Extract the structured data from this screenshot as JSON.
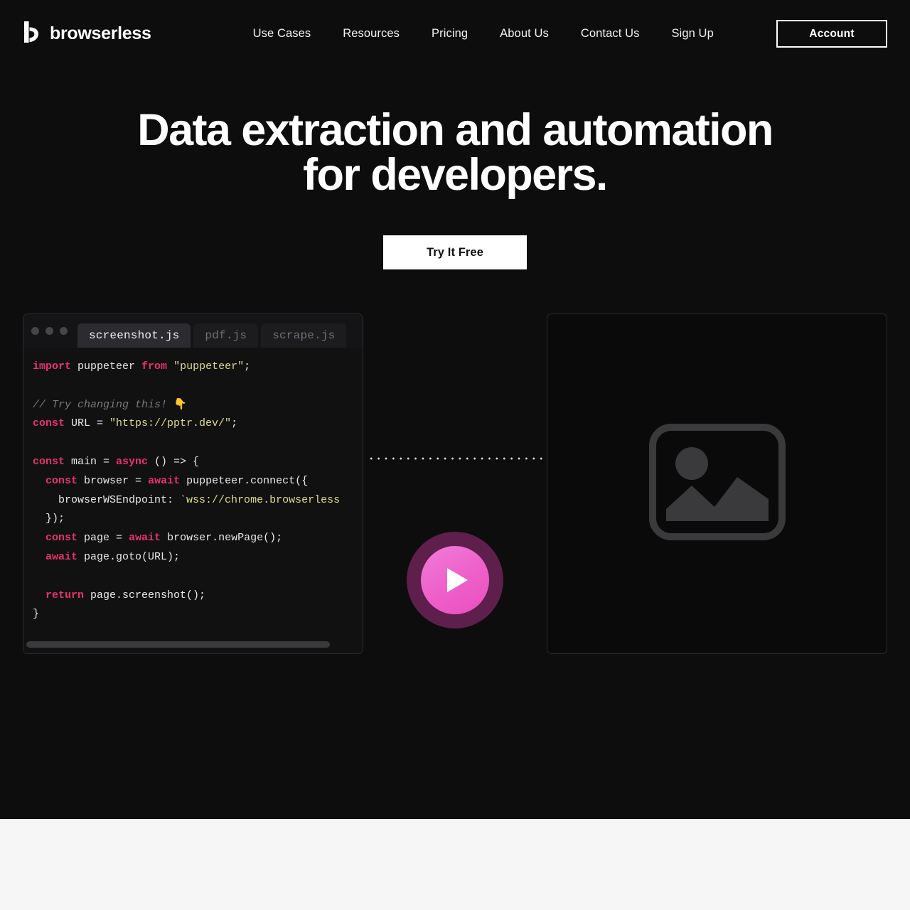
{
  "header": {
    "brand": {
      "name": "browserless",
      "logo_icon": "browserless-b-logo-icon"
    },
    "nav": [
      {
        "label": "Use Cases"
      },
      {
        "label": "Resources"
      },
      {
        "label": "Pricing"
      },
      {
        "label": "About Us"
      },
      {
        "label": "Contact Us"
      },
      {
        "label": "Sign Up"
      }
    ],
    "account_label": "Account"
  },
  "hero": {
    "title": "Data extraction and automation for developers.",
    "cta_label": "Try It Free"
  },
  "demo": {
    "editor": {
      "window_dots": [
        "dot-1",
        "dot-2",
        "dot-3"
      ],
      "tabs": [
        {
          "label": "screenshot.js",
          "active": true
        },
        {
          "label": "pdf.js",
          "active": false
        },
        {
          "label": "scrape.js",
          "active": false
        }
      ],
      "scrollbar": {
        "name": "horizontal-scrollbar"
      },
      "code_lines": [
        [
          {
            "t": "kw",
            "v": "import"
          },
          {
            "t": "pln",
            "v": " puppeteer "
          },
          {
            "t": "kw",
            "v": "from"
          },
          {
            "t": "pln",
            "v": " "
          },
          {
            "t": "str",
            "v": "\"puppeteer\""
          },
          {
            "t": "pln",
            "v": ";"
          }
        ],
        [
          {
            "t": "pln",
            "v": ""
          }
        ],
        [
          {
            "t": "cmt",
            "v": "// Try changing this! "
          },
          {
            "t": "pln",
            "v": "👇"
          }
        ],
        [
          {
            "t": "kw",
            "v": "const"
          },
          {
            "t": "pln",
            "v": " URL = "
          },
          {
            "t": "str",
            "v": "\"https://pptr.dev/\""
          },
          {
            "t": "pln",
            "v": ";"
          }
        ],
        [
          {
            "t": "pln",
            "v": ""
          }
        ],
        [
          {
            "t": "kw",
            "v": "const"
          },
          {
            "t": "pln",
            "v": " main = "
          },
          {
            "t": "kw",
            "v": "async"
          },
          {
            "t": "pln",
            "v": " () => {"
          }
        ],
        [
          {
            "t": "pln",
            "v": "  "
          },
          {
            "t": "kw",
            "v": "const"
          },
          {
            "t": "pln",
            "v": " browser = "
          },
          {
            "t": "kw",
            "v": "await"
          },
          {
            "t": "pln",
            "v": " puppeteer.connect({"
          }
        ],
        [
          {
            "t": "pln",
            "v": "    browserWSEndpoint: "
          },
          {
            "t": "str",
            "v": "`wss://chrome.browserless"
          }
        ],
        [
          {
            "t": "pln",
            "v": "  });"
          }
        ],
        [
          {
            "t": "pln",
            "v": "  "
          },
          {
            "t": "kw",
            "v": "const"
          },
          {
            "t": "pln",
            "v": " page = "
          },
          {
            "t": "kw",
            "v": "await"
          },
          {
            "t": "pln",
            "v": " browser.newPage();"
          }
        ],
        [
          {
            "t": "pln",
            "v": "  "
          },
          {
            "t": "kw",
            "v": "await"
          },
          {
            "t": "pln",
            "v": " page.goto(URL);"
          }
        ],
        [
          {
            "t": "pln",
            "v": ""
          }
        ],
        [
          {
            "t": "pln",
            "v": "  "
          },
          {
            "t": "kw",
            "v": "return"
          },
          {
            "t": "pln",
            "v": " page.screenshot();"
          }
        ],
        [
          {
            "t": "pln",
            "v": "}"
          }
        ]
      ]
    },
    "connector": {
      "name": "dotted-connector"
    },
    "play_button": {
      "name": "play-button",
      "icon": "play-triangle-icon"
    },
    "preview": {
      "name": "screenshot-preview-panel",
      "icon": "image-placeholder-icon"
    }
  },
  "colors": {
    "page_background": "#0d0d0d",
    "next_section_background": "#f6f6f6",
    "accent_pink": "#ee5fca",
    "accent_pink_dark": "#5e1f4c",
    "keyword": "#e5336d",
    "string": "#dcdc8c",
    "comment": "#7b7b80",
    "panel_background": "#111112",
    "panel_border": "#2b2b2e"
  }
}
